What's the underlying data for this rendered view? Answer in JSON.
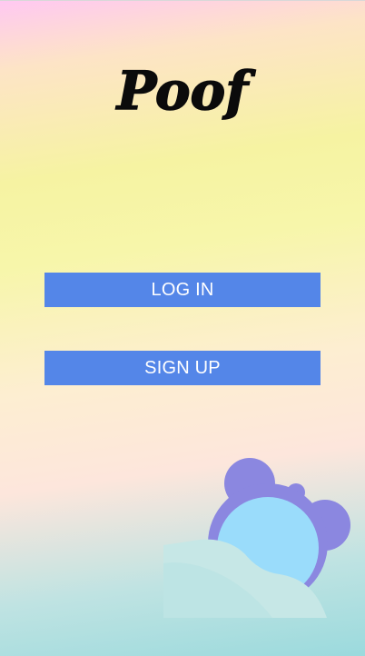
{
  "app": {
    "title": "Poof"
  },
  "actions": {
    "login_label": "LOG IN",
    "signup_label": "SIGN UP"
  },
  "icons": {
    "decoration": "alarm-clock-icon"
  },
  "colors": {
    "button": "#5486e8",
    "button_text": "#ffffff",
    "clock_body": "#8b87e0",
    "clock_face": "#9adcfb"
  }
}
